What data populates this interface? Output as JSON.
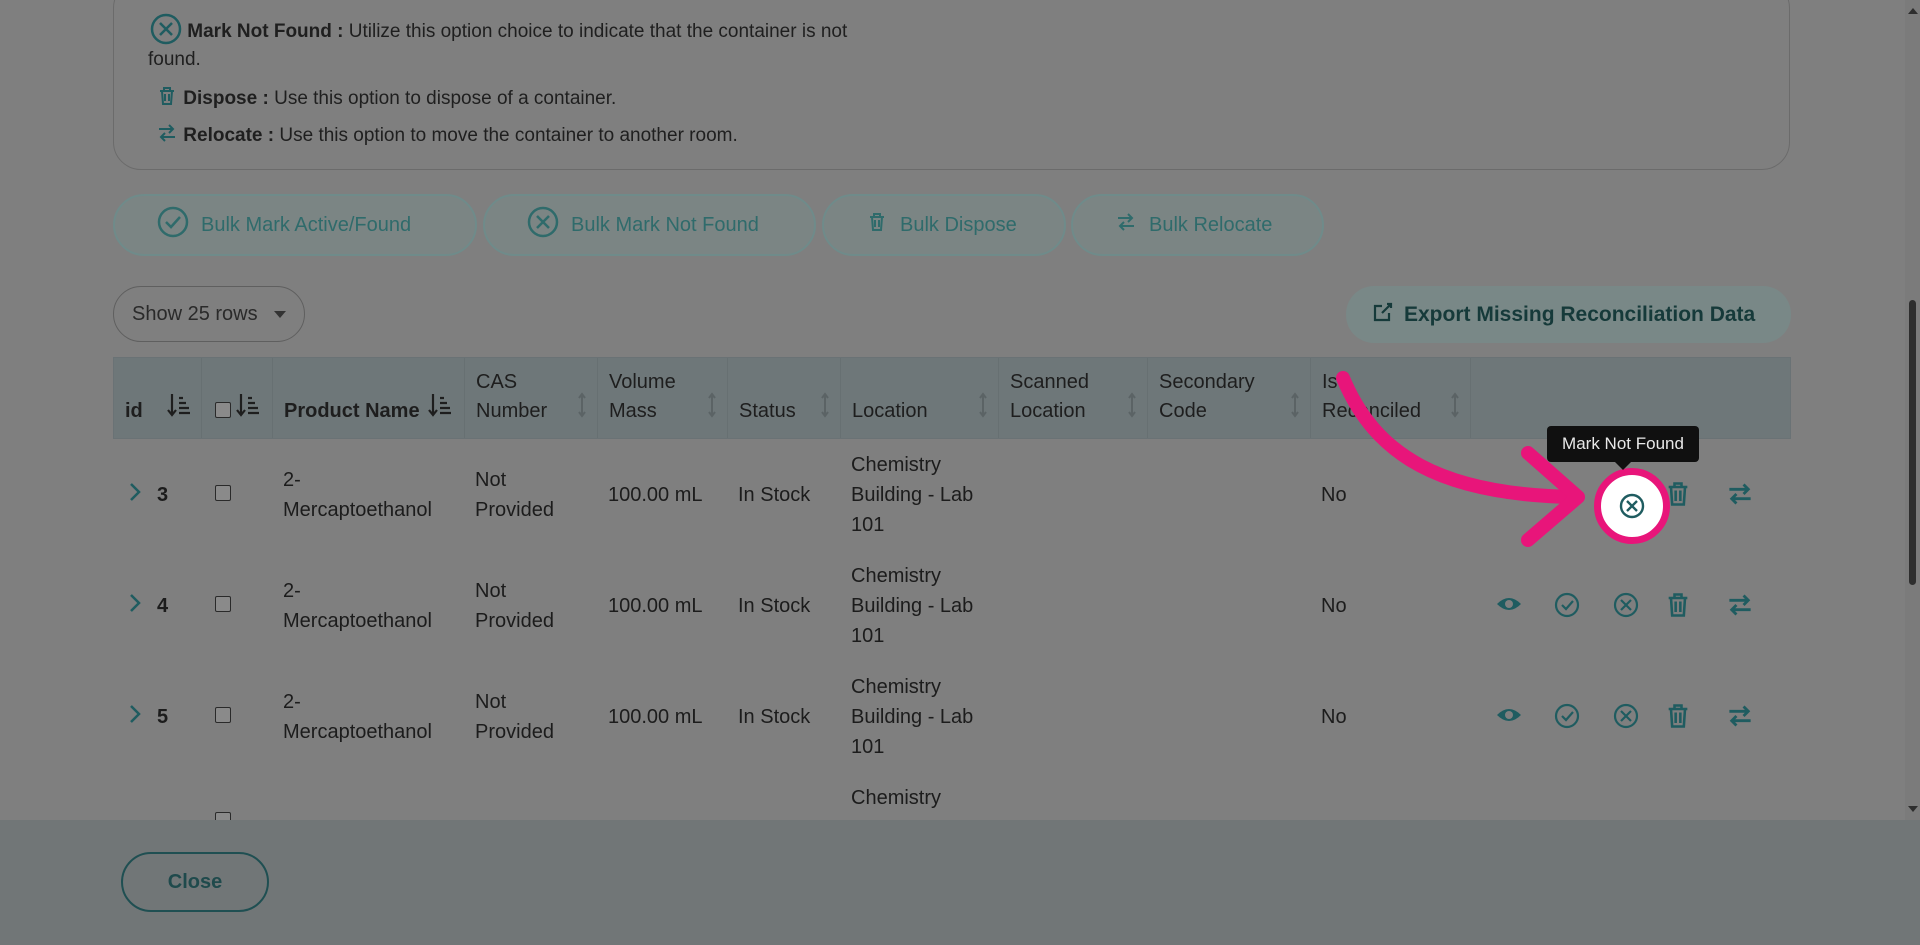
{
  "info": {
    "mark_not_found_title": "Mark Not Found :",
    "mark_not_found_text": " Utilize this option choice to indicate that the container is not",
    "mark_not_found_text2": "found.",
    "dispose_title": "Dispose :",
    "dispose_text": " Use this option to dispose of a container.",
    "relocate_title": "Relocate :",
    "relocate_text": " Use this option to move the container to another room."
  },
  "bulk": {
    "found_label": "Bulk Mark Active/Found",
    "not_found_label": "Bulk Mark Not Found",
    "dispose_label": "Bulk Dispose",
    "relocate_label": "Bulk Relocate"
  },
  "rows_select": {
    "value": "Show 25 rows"
  },
  "export": {
    "label": "Export Missing Reconciliation Data"
  },
  "table": {
    "headers": {
      "id": "id",
      "product": "Product Name",
      "cas_1": "CAS",
      "cas_2": "Number",
      "vol_1": "Volume",
      "vol_2": "Mass",
      "status": "Status",
      "location": "Location",
      "scan_1": "Scanned",
      "scan_2": "Location",
      "sec_1": "Secondary",
      "sec_2": "Code",
      "rec_1": "Is",
      "rec_2": "Reconciled"
    },
    "rows": [
      {
        "id": "3",
        "product_1": "2-",
        "product_2": "Mercaptoethanol",
        "cas_1": "Not",
        "cas_2": "Provided",
        "volume": "100.00 mL",
        "status": "In Stock",
        "loc_1": "Chemistry",
        "loc_2": "Building - Lab",
        "loc_3": "101",
        "reconciled": "No"
      },
      {
        "id": "4",
        "product_1": "2-",
        "product_2": "Mercaptoethanol",
        "cas_1": "Not",
        "cas_2": "Provided",
        "volume": "100.00 mL",
        "status": "In Stock",
        "loc_1": "Chemistry",
        "loc_2": "Building - Lab",
        "loc_3": "101",
        "reconciled": "No"
      },
      {
        "id": "5",
        "product_1": "2-",
        "product_2": "Mercaptoethanol",
        "cas_1": "Not",
        "cas_2": "Provided",
        "volume": "100.00 mL",
        "status": "In Stock",
        "loc_1": "Chemistry",
        "loc_2": "Building - Lab",
        "loc_3": "101",
        "reconciled": "No"
      },
      {
        "loc_1": "Chemistry"
      }
    ]
  },
  "tooltip": {
    "text": "Mark Not Found"
  },
  "footer": {
    "close_label": "Close"
  },
  "colors": {
    "teal": "#1f5c60",
    "highlight": "#e8157a",
    "overlay": "#7f7f7f"
  }
}
